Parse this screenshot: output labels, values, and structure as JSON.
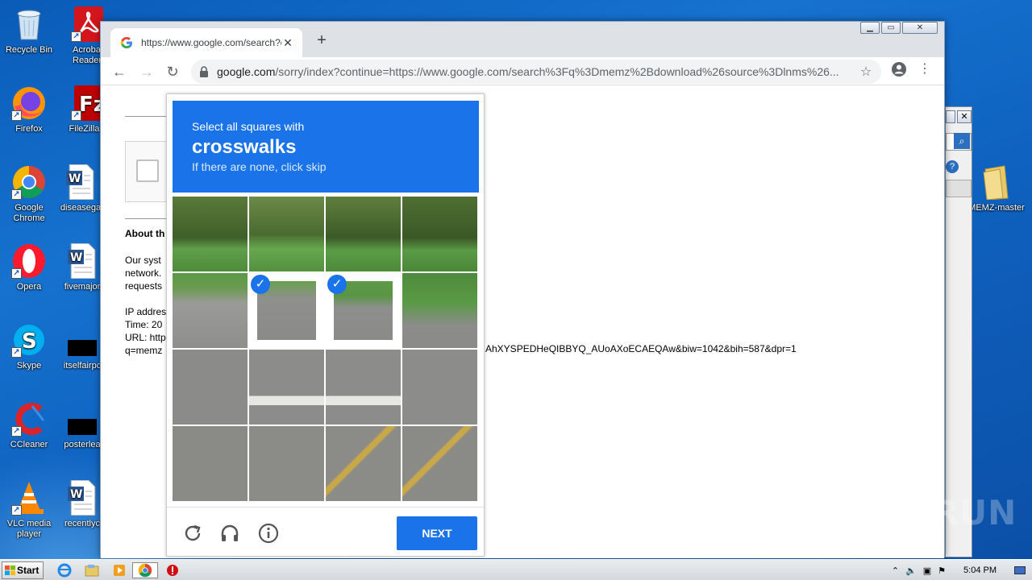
{
  "desktop": {
    "icons": [
      {
        "label": "Recycle Bin",
        "icon": "recycle-bin-icon"
      },
      {
        "label": "Acrobat Reader",
        "icon": "acrobat-icon"
      },
      {
        "label": "Firefox",
        "icon": "firefox-icon"
      },
      {
        "label": "FileZilla C",
        "icon": "filezilla-icon"
      },
      {
        "label": "Google Chrome",
        "icon": "chrome-icon"
      },
      {
        "label": "diseasega",
        "icon": "word-doc-icon"
      },
      {
        "label": "Opera",
        "icon": "opera-icon"
      },
      {
        "label": "fivemajor",
        "icon": "word-doc-icon"
      },
      {
        "label": "Skype",
        "icon": "skype-icon"
      },
      {
        "label": "itselfairpc",
        "icon": "black-file-icon"
      },
      {
        "label": "CCleaner",
        "icon": "ccleaner-icon"
      },
      {
        "label": "posterlea",
        "icon": "black-file-icon"
      },
      {
        "label": "VLC media player",
        "icon": "vlc-icon"
      },
      {
        "label": "recentlyc",
        "icon": "word-doc-icon"
      },
      {
        "label": "MEMZ-master",
        "icon": "folder-icon"
      }
    ]
  },
  "browser": {
    "tab_title": "https://www.google.com/search?q=",
    "url_host": "google.com",
    "url_rest": "/sorry/index?continue=https://www.google.com/search%3Fq%3Dmemz%2Bdownload%26source%3Dlnms%26...",
    "window_buttons": [
      "▁",
      "▭",
      "✕"
    ]
  },
  "page": {
    "about_heading": "About th",
    "para1": [
      "Our syst",
      "network.",
      "requests"
    ],
    "para2": [
      "IP addres",
      "Time: 20",
      "URL: http",
      "q=memz"
    ],
    "url_tail": "AhXYSPEDHeQIBBYQ_AUoAXoECAEQAw&biw=1042&bih=587&dpr=1"
  },
  "captcha": {
    "instruction": "Select all squares with",
    "target": "crosswalks",
    "hint": "If there are none, click skip",
    "selected_tiles": [
      5,
      6
    ],
    "next_label": "NEXT"
  },
  "taskbar": {
    "start_label": "Start",
    "clock": "5:04 PM"
  },
  "watermark": "ANY RUN"
}
